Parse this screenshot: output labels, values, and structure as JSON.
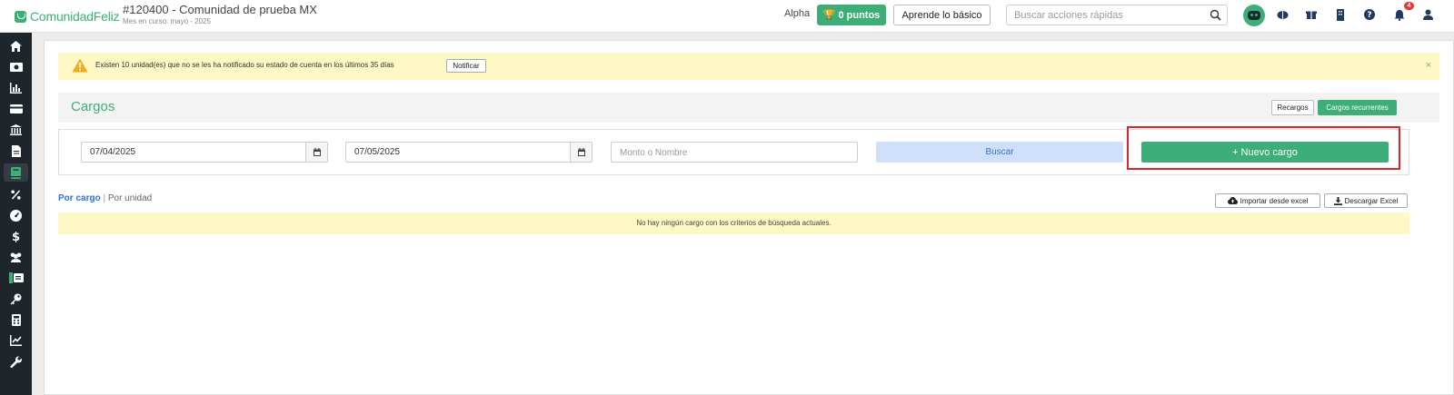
{
  "app": {
    "logo_text": "ComunidadFeliz",
    "community_name": "#120400 - Comunidad de prueba MX",
    "current_month": "Mes en curso: mayo - 2025"
  },
  "topbar": {
    "alpha_label": "Alpha",
    "points_label": "0 puntos",
    "learn_label": "Aprende lo básico",
    "search_placeholder": "Buscar acciones rápidas",
    "notification_count": "4"
  },
  "sidebar": {
    "items": [
      {
        "icon": "home-icon"
      },
      {
        "icon": "money-icon"
      },
      {
        "icon": "bar-chart-icon"
      },
      {
        "icon": "credit-card-icon"
      },
      {
        "icon": "bank-icon"
      },
      {
        "icon": "document-icon"
      },
      {
        "icon": "book-icon",
        "active": true
      },
      {
        "icon": "percent-icon"
      },
      {
        "icon": "gauge-icon"
      },
      {
        "icon": "dollar-icon"
      },
      {
        "icon": "users-icon"
      },
      {
        "icon": "id-card-icon"
      },
      {
        "icon": "key-icon"
      },
      {
        "icon": "calculator-icon"
      },
      {
        "icon": "line-chart-icon"
      },
      {
        "icon": "wrench-icon"
      }
    ]
  },
  "alert": {
    "text": "Existen 10 unidad(es) que no se les ha notificado su estado de cuenta en los últimos 35 días",
    "notify_label": "Notificar",
    "close_label": "×"
  },
  "cargos": {
    "title": "Cargos",
    "recargos_label": "Recargos",
    "recurrentes_label": "Cargos recurrentes"
  },
  "filters": {
    "date_from": "07/04/2025",
    "date_to": "07/05/2025",
    "amount_placeholder": "Monto o Nombre",
    "search_label": "Buscar",
    "new_charge_label": "+ Nuevo cargo"
  },
  "view": {
    "by_charge": "Por cargo",
    "separator": " | ",
    "by_unit": "Por unidad",
    "import_label": "Importar desde excel",
    "download_label": "Descargar Excel"
  },
  "empty_message": "No hay ningún cargo con los criterios de búsqueda actuales.",
  "colors": {
    "brand_green": "#3dae78",
    "sidebar_bg": "#1f262b",
    "alert_bg": "#fdf8c4",
    "highlight_red": "#d9262c"
  }
}
